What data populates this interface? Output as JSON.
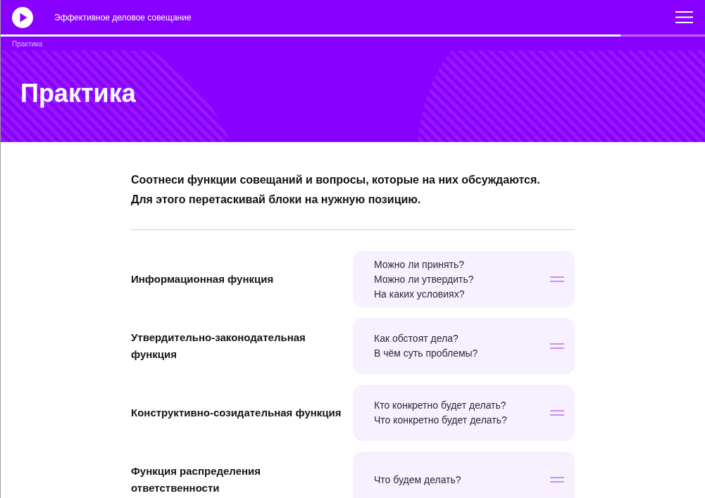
{
  "header": {
    "title": "Эффективное деловое совещание",
    "progress": {
      "level": 0.88
    }
  },
  "breadcrumb": "Практика",
  "hero": {
    "title": "Практика"
  },
  "instructions": {
    "lines": [
      "Соотнеси функции совещаний и вопросы, которые на них обсуждаются.",
      "Для этого перетаскивай блоки на нужную позицию."
    ]
  },
  "pairs": [
    {
      "function": "Информационная функция",
      "questions": [
        "Можно ли принять?",
        "Можно ли утвердить?",
        "На каких условиях?"
      ]
    },
    {
      "function": "Утвердительно-законодательная функция",
      "questions": [
        "Как обстоят дела?",
        "В чём суть проблемы?"
      ]
    },
    {
      "function": "Конструктивно-созидательная функция",
      "questions": [
        "Кто конкретно будет делать?",
        "Что конкретно будет делать?"
      ]
    },
    {
      "function": "Функция распределения ответственности",
      "questions": [
        "Что будем делать?"
      ]
    }
  ]
}
